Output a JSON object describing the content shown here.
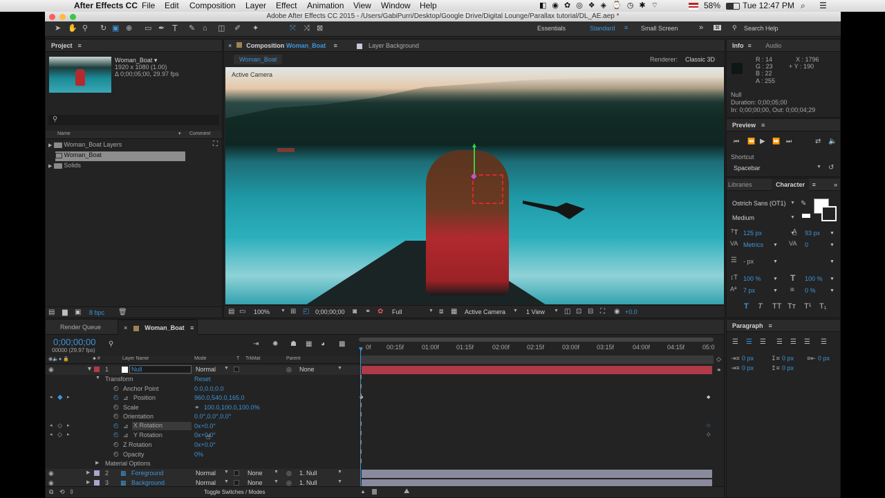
{
  "menubar": {
    "apple": "",
    "app_name": "After Effects CC",
    "items": [
      "File",
      "Edit",
      "Composition",
      "Layer",
      "Effect",
      "Animation",
      "View",
      "Window",
      "Help"
    ],
    "battery": "58%",
    "clock": "Tue 12:47 PM"
  },
  "window_title": "Adobe After Effects CC 2015 - /Users/GabiPurri/Desktop/Google Drive/Digital Lounge/Parallax tutorial/DL_AE.aep *",
  "workspaces": {
    "essentials": "Essentials",
    "standard": "Standard",
    "small_screen": "Small Screen",
    "search": "Search Help"
  },
  "project": {
    "title": "Project",
    "item_name": "Woman_Boat ▾",
    "item_dims": "1920 x 1080 (1.00)",
    "item_duration": "Δ 0;00;05;00, 29.97 fps",
    "col_name": "Name",
    "col_comment": "Comment",
    "items": [
      {
        "label": "Woman_Boat Layers",
        "type": "folder"
      },
      {
        "label": "Woman_Boat",
        "type": "comp"
      },
      {
        "label": "Solids",
        "type": "folder"
      }
    ],
    "bpc": "8 bpc"
  },
  "composition": {
    "tab_prefix": "Composition",
    "tab_name": "Woman_Boat",
    "tab2": "Layer Background",
    "comp_chip": "Woman_Boat",
    "renderer_label": "Renderer:",
    "renderer_value": "Classic 3D",
    "active_camera_overlay": "Active Camera",
    "zoom": "100%",
    "timecode": "0;00;00;00",
    "resolution": "Full",
    "camera": "Active Camera",
    "view": "1 View",
    "exposure": "+0.0"
  },
  "info": {
    "tab": "Info",
    "tab2": "Audio",
    "r": "R : 14",
    "g": "G : 23",
    "b": "B : 22",
    "a": "A : 255",
    "x": "X : 1796",
    "y": "+ Y : 190",
    "name": "Null",
    "duration": "Duration: 0;00;05;00",
    "inout": "In: 0;00;00;00, Out: 0;00;04;29"
  },
  "preview": {
    "title": "Preview",
    "shortcut_label": "Shortcut",
    "shortcut_value": "Spacebar"
  },
  "character": {
    "tab_libraries": "Libraries",
    "tab_character": "Character",
    "font": "Ostrich Sans (OT1)",
    "style": "Medium",
    "size": "125 px",
    "leading": "93 px",
    "kerning": "Metrics",
    "tracking": "0",
    "stroke": "- px",
    "vscale": "100 %",
    "hscale": "100 %",
    "baseline": "7 px",
    "tsume": "0 %",
    "styles": [
      "T",
      "T",
      "TT",
      "Tт",
      "T¹",
      "T₁"
    ]
  },
  "paragraph": {
    "title": "Paragraph",
    "values": [
      "0 px",
      "0 px",
      "0 px",
      "0 px",
      "0 px"
    ]
  },
  "timeline": {
    "tab_render": "Render Queue",
    "tab_comp": "Woman_Boat",
    "timecode": "0;00;00;00",
    "fps": "00000 (29.97 fps)",
    "col_layer_name": "Layer Name",
    "col_mode": "Mode",
    "col_t": "T",
    "col_trkmat": "TrkMat",
    "col_parent": "Parent",
    "ticks": [
      "0f",
      "00:15f",
      "01:00f",
      "01:15f",
      "02:00f",
      "02:15f",
      "03:00f",
      "03:15f",
      "04:00f",
      "04:15f",
      "05:0"
    ],
    "layer1": {
      "num": "1",
      "name": "Null",
      "mode": "Normal",
      "parent": "None"
    },
    "transform": "Transform",
    "reset": "Reset",
    "props": [
      {
        "name": "Anchor Point",
        "value": "0.0,0.0,0.0"
      },
      {
        "name": "Position",
        "value": "960.0,540.0,165.0"
      },
      {
        "name": "Scale",
        "value": "100.0,100.0,100.0%"
      },
      {
        "name": "Orientation",
        "value": "0.0°,0.0°,0.0°"
      },
      {
        "name": "X Rotation",
        "value": "0x+0.0°"
      },
      {
        "name": "Y Rotation",
        "value": "0x+0.0°"
      },
      {
        "name": "Z Rotation",
        "value": "0x+0.0°"
      },
      {
        "name": "Opacity",
        "value": "0%"
      }
    ],
    "material": "Material Options",
    "layer2": {
      "num": "2",
      "name": "Foreground",
      "mode": "Normal",
      "trkmat": "None",
      "parent": "1. Null"
    },
    "layer3": {
      "num": "3",
      "name": "Background",
      "mode": "Normal",
      "trkmat": "None",
      "parent": "1. Null"
    },
    "toggle": "Toggle Switches / Modes"
  },
  "colors": {
    "accent": "#3d95d8",
    "layer_red": "#b03a48",
    "layer_lavender": "#8a8a9e"
  }
}
